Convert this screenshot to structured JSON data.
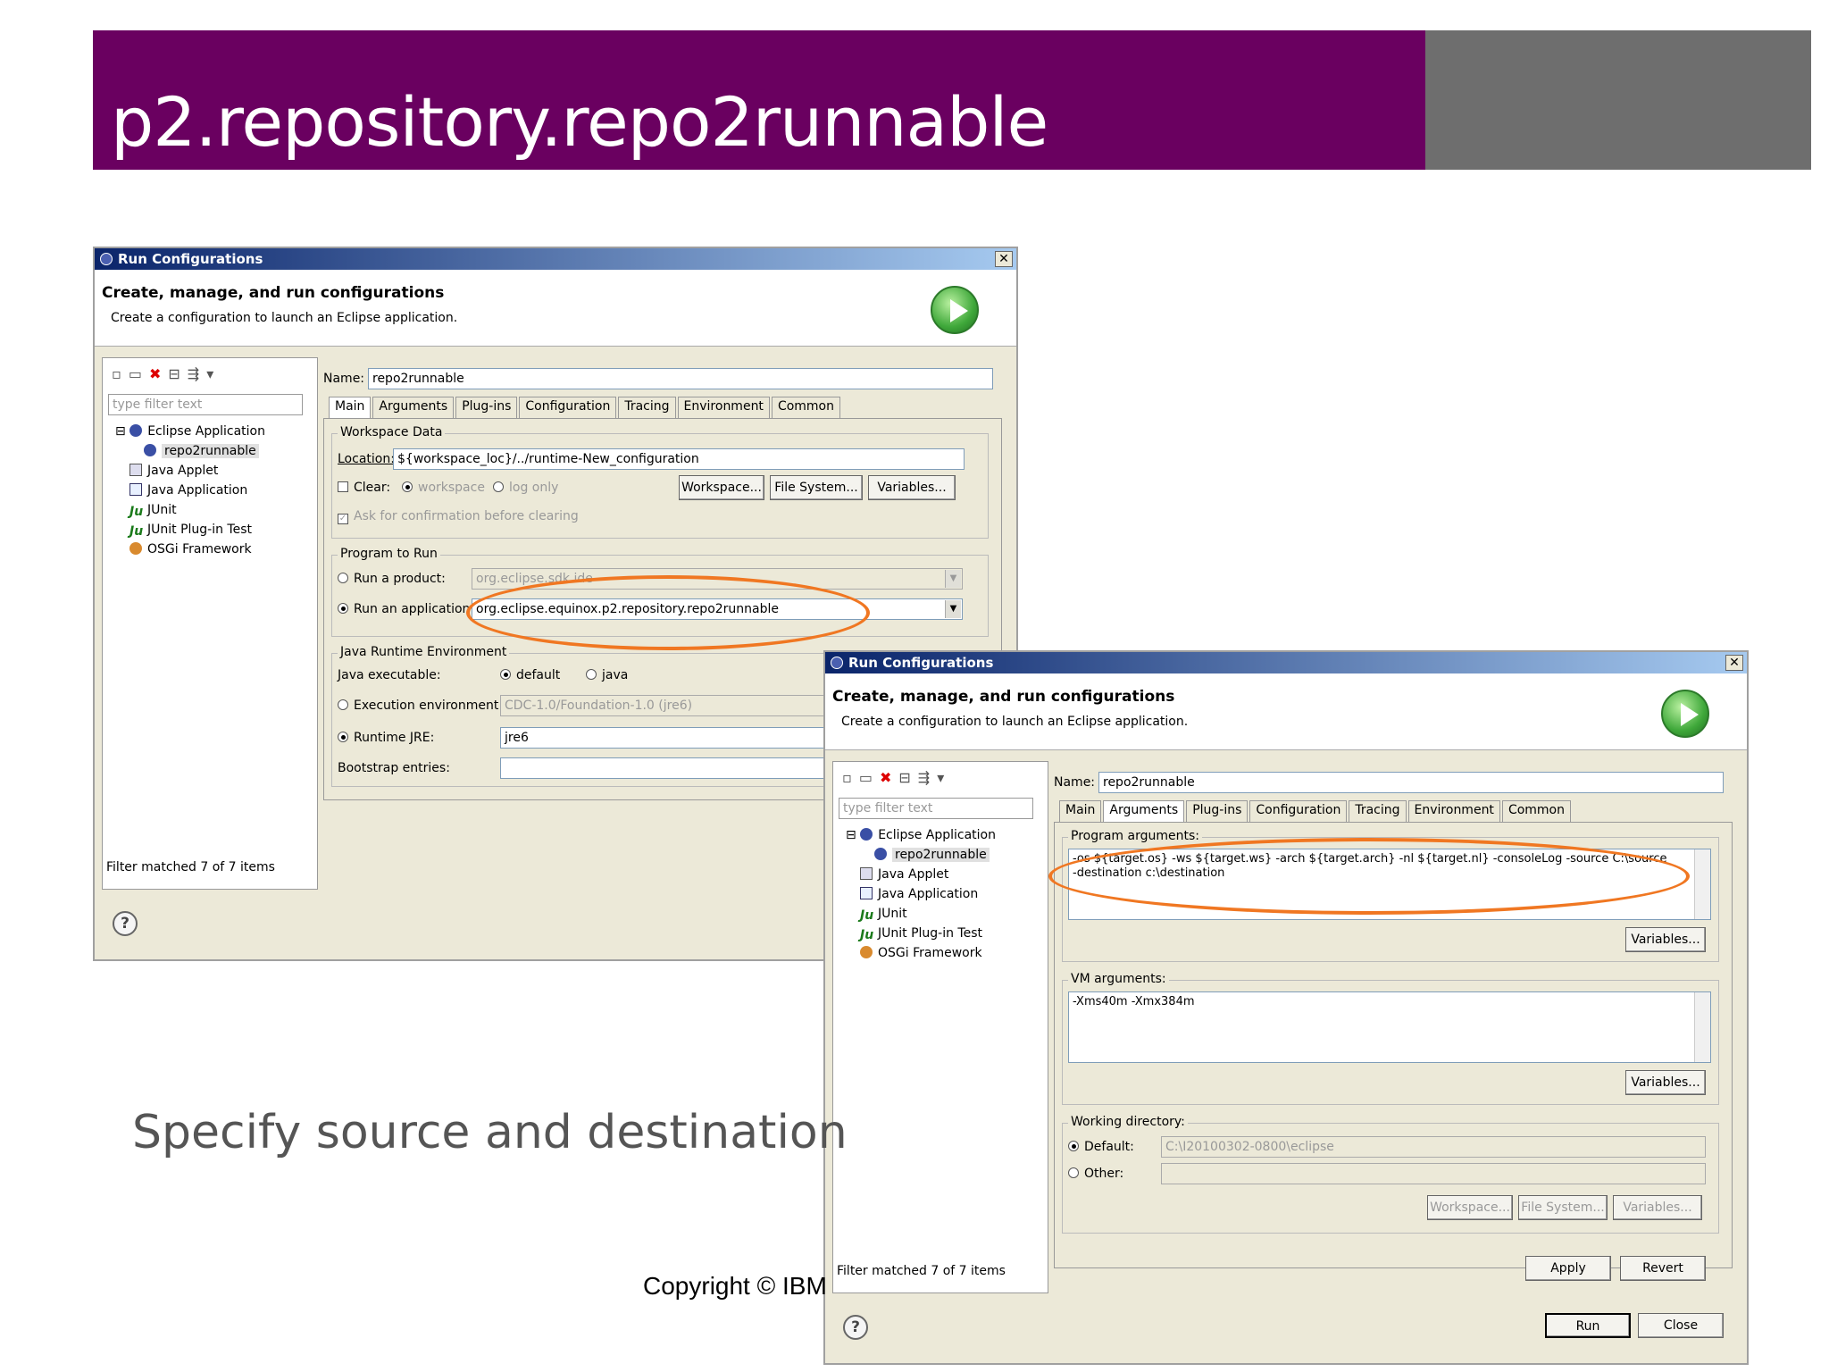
{
  "slide": {
    "title": "p2.repository.repo2runnable",
    "subtitle": "Specify source and destination",
    "copyright": "Copyright © IBM"
  },
  "dialog1": {
    "window_title": "Run Configurations",
    "header_title": "Create, manage, and run configurations",
    "header_desc": "Create a configuration to launch an Eclipse application.",
    "filter_placeholder": "type filter text",
    "tree": [
      "Eclipse Application",
      "repo2runnable",
      "Java Applet",
      "Java Application",
      "JUnit",
      "JUnit Plug-in Test",
      "OSGi Framework"
    ],
    "filter_msg": "Filter matched 7 of 7 items",
    "name_label": "Name:",
    "name_value": "repo2runnable",
    "tabs": [
      "Main",
      "Arguments",
      "Plug-ins",
      "Configuration",
      "Tracing",
      "Environment",
      "Common"
    ],
    "workspace_data": "Workspace Data",
    "location_label": "Location:",
    "location_value": "${workspace_loc}/../runtime-New_configuration",
    "clear_label": "Clear:",
    "workspace_radio": "workspace",
    "log_only": "log only",
    "btn_workspace": "Workspace...",
    "btn_filesystem": "File System...",
    "btn_variables": "Variables...",
    "ask_confirm": "Ask for confirmation before clearing",
    "program_to_run": "Program to Run",
    "run_product": "Run a product:",
    "product_value": "org.eclipse.sdk.ide",
    "run_app": "Run an application:",
    "app_value": "org.eclipse.equinox.p2.repository.repo2runnable",
    "jre_group": "Java Runtime Environment",
    "java_exec": "Java executable:",
    "default_opt": "default",
    "java_opt": "java",
    "exec_env": "Execution environment:",
    "exec_env_value": "CDC-1.0/Foundation-1.0 (jre6)",
    "runtime_jre": "Runtime JRE:",
    "runtime_jre_value": "jre6",
    "bootstrap": "Bootstrap entries:"
  },
  "dialog2": {
    "window_title": "Run Configurations",
    "header_title": "Create, manage, and run configurations",
    "header_desc": "Create a configuration to launch an Eclipse application.",
    "filter_placeholder": "type filter text",
    "tree": [
      "Eclipse Application",
      "repo2runnable",
      "Java Applet",
      "Java Application",
      "JUnit",
      "JUnit Plug-in Test",
      "OSGi Framework"
    ],
    "filter_msg": "Filter matched 7 of 7 items",
    "name_label": "Name:",
    "name_value": "repo2runnable",
    "tabs": [
      "Main",
      "Arguments",
      "Plug-ins",
      "Configuration",
      "Tracing",
      "Environment",
      "Common"
    ],
    "program_args_label": "Program arguments:",
    "program_args_line1": "-os ${target.os} -ws ${target.ws} -arch ${target.arch} -nl ${target.nl} -consoleLog -source C:\\source",
    "program_args_line2": "-destination c:\\destination",
    "btn_variables": "Variables...",
    "vm_args_label": "VM arguments:",
    "vm_args_value": "-Xms40m -Xmx384m",
    "working_dir": "Working directory:",
    "default_label": "Default:",
    "default_value": "C:\\I20100302-0800\\eclipse",
    "other_label": "Other:",
    "btn_workspace": "Workspace...",
    "btn_filesystem": "File System...",
    "btn_apply": "Apply",
    "btn_revert": "Revert",
    "btn_run": "Run",
    "btn_close": "Close"
  },
  "colors": {
    "title_bg": "#6a0060",
    "title_accent": "#6e6e6e",
    "highlight_oval": "#f07722"
  }
}
